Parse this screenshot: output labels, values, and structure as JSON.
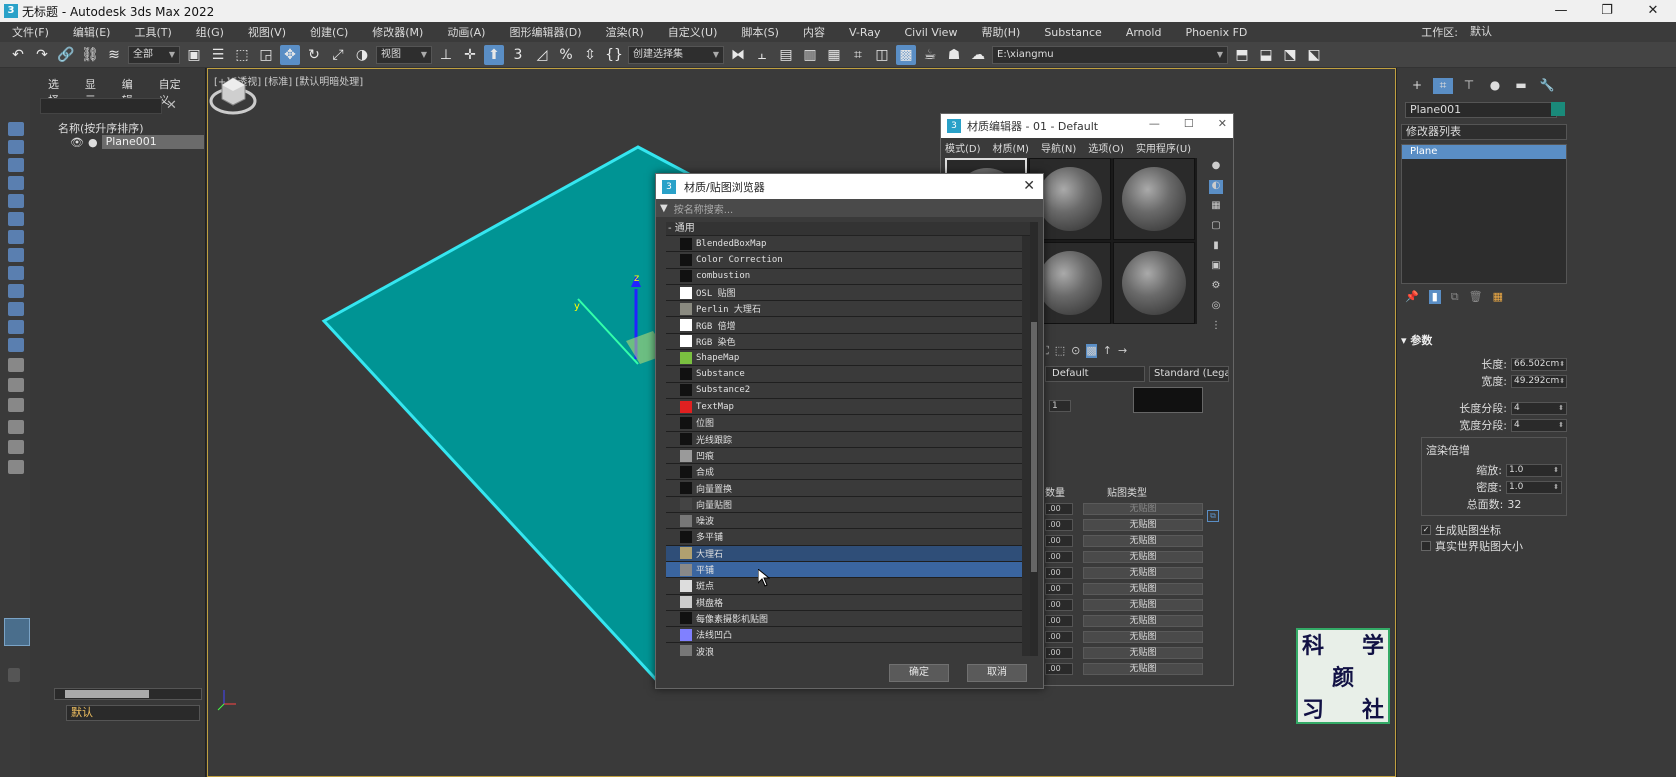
{
  "window": {
    "title": "无标题 - Autodesk 3ds Max 2022",
    "controls": [
      "—",
      "❐",
      "✕"
    ]
  },
  "menubar": {
    "items": [
      "文件(F)",
      "编辑(E)",
      "工具(T)",
      "组(G)",
      "视图(V)",
      "创建(C)",
      "修改器(M)",
      "动画(A)",
      "图形编辑器(D)",
      "渲染(R)",
      "自定义(U)",
      "脚本(S)",
      "内容",
      "V-Ray",
      "Civil View",
      "帮助(H)",
      "Substance",
      "Arnold",
      "Phoenix FD"
    ],
    "workspace_label": "工作区:",
    "workspace_value": "默认"
  },
  "toolbar": {
    "selection_filter": "全部",
    "ref_coord": "视图",
    "named_sel": "创建选择集",
    "path": "E:\\xiangmu"
  },
  "scene_explorer": {
    "tabs": [
      "选择",
      "显示",
      "编辑",
      "自定义"
    ],
    "header": "名称(按升序排序)",
    "objects": [
      "Plane001"
    ],
    "layer": "默认"
  },
  "viewport": {
    "label": "[+] [透视] [标准] [默认明暗处理]",
    "colors": {
      "plane": "#009494",
      "edge": "#35e6f0"
    }
  },
  "command_panel": {
    "object_name": "Plane001",
    "modifier_list": "修改器列表",
    "stack_item": "Plane",
    "params_title": "参数",
    "length_label": "长度:",
    "length_value": "66.502cm",
    "width_label": "宽度:",
    "width_value": "49.292cm",
    "length_segs_label": "长度分段:",
    "length_segs_value": "4",
    "width_segs_label": "宽度分段:",
    "width_segs_value": "4",
    "render_mult_label": "渲染倍增",
    "scale_label": "缩放:",
    "scale_value": "1.0",
    "density_label": "密度:",
    "density_value": "1.0",
    "total_faces_label": "总面数:",
    "total_faces_value": "32",
    "gen_mapping_label": "生成贴图坐标",
    "real_world_label": "真实世界贴图大小"
  },
  "material_editor": {
    "title": "材质编辑器 - 01 - Default",
    "menu": [
      "模式(D)",
      "材质(M)",
      "导航(N)",
      "选项(O)",
      "实用程序(U)"
    ],
    "material_name": "Default",
    "material_type": "Standard (Legacy)",
    "maps_header_amount": "数量",
    "maps_header_type": "贴图类型",
    "map_amounts": [
      ".00",
      ".00",
      ".00",
      ".00",
      ".00",
      ".00",
      ".00",
      ".00",
      ".00",
      ".00",
      ".00",
      ".00"
    ],
    "map_button": "无贴图",
    "spinner_value": "1"
  },
  "browser": {
    "title": "材质/贴图浏览器",
    "search_placeholder": "按名称搜索...",
    "group": "- 通用",
    "items": [
      {
        "label": "BlendedBoxMap",
        "swatch": "#111111"
      },
      {
        "label": "Color Correction",
        "swatch": "#111111"
      },
      {
        "label": "combustion",
        "swatch": "#111111"
      },
      {
        "label": "OSL 贴图",
        "swatch": "#ffffff"
      },
      {
        "label": "Perlin 大理石",
        "swatch": "#8a8a80"
      },
      {
        "label": "RGB 倍增",
        "swatch": "#ffffff"
      },
      {
        "label": "RGB 染色",
        "swatch": "#ffffff"
      },
      {
        "label": "ShapeMap",
        "swatch": "#7ac040"
      },
      {
        "label": "Substance",
        "swatch": "#111111"
      },
      {
        "label": "Substance2",
        "swatch": "#111111"
      },
      {
        "label": "TextMap",
        "swatch": "#e02020"
      },
      {
        "label": "位图",
        "swatch": "#111111"
      },
      {
        "label": "光线跟踪",
        "swatch": "#111111"
      },
      {
        "label": "凹痕",
        "swatch": "#9a9a9a"
      },
      {
        "label": "合成",
        "swatch": "#111111"
      },
      {
        "label": "向量置换",
        "swatch": "#111111"
      },
      {
        "label": "向量贴图",
        "swatch": "#444444"
      },
      {
        "label": "噪波",
        "swatch": "#777777"
      },
      {
        "label": "多平铺",
        "swatch": "#111111"
      },
      {
        "label": "大理石",
        "swatch": "#b0a070"
      },
      {
        "label": "平铺",
        "swatch": "#888888"
      },
      {
        "label": "斑点",
        "swatch": "#dddddd"
      },
      {
        "label": "棋盘格",
        "swatch": "#cccccc"
      },
      {
        "label": "每像素摄影机贴图",
        "swatch": "#111111"
      },
      {
        "label": "法线凹凸",
        "swatch": "#8080ff"
      },
      {
        "label": "波浪",
        "swatch": "#777777"
      }
    ],
    "hover_index": 19,
    "selected_index": 20,
    "ok": "确定",
    "cancel": "取消"
  },
  "watermark": [
    "科",
    "学",
    "颜",
    "习",
    "社"
  ]
}
